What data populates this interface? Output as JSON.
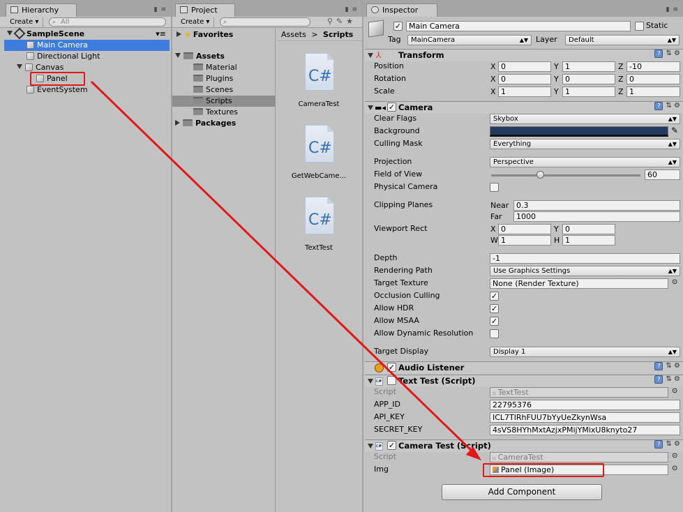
{
  "hierarchy": {
    "tab": "Hierarchy",
    "create": "Create",
    "search_placeholder": "All",
    "scene": "SampleScene",
    "items": [
      "Main Camera",
      "Directional Light",
      "Canvas",
      "Panel",
      "EventSystem"
    ]
  },
  "project": {
    "tab": "Project",
    "create": "Create",
    "favorites": "Favorites",
    "assets": "Assets",
    "folders": [
      "Material",
      "Plugins",
      "Scenes",
      "Scripts",
      "Textures"
    ],
    "packages": "Packages",
    "breadcrumb": [
      "Assets",
      "Scripts"
    ],
    "files": [
      {
        "icon": "C#",
        "name": "CameraTest"
      },
      {
        "icon": "C#",
        "name": "GetWebCame..."
      },
      {
        "icon": "C#",
        "name": "TextTest"
      }
    ]
  },
  "inspector": {
    "tab": "Inspector",
    "object_name": "Main Camera",
    "static_label": "Static",
    "tag_label": "Tag",
    "tag_value": "MainCamera",
    "layer_label": "Layer",
    "layer_value": "Default",
    "transform": {
      "title": "Transform",
      "position_label": "Position",
      "rotation_label": "Rotation",
      "scale_label": "Scale",
      "x": "X",
      "y": "Y",
      "z": "Z",
      "position": [
        "0",
        "1",
        "-10"
      ],
      "rotation": [
        "0",
        "0",
        "0"
      ],
      "scale": [
        "1",
        "1",
        "1"
      ]
    },
    "camera": {
      "title": "Camera",
      "clear_flags_label": "Clear Flags",
      "clear_flags": "Skybox",
      "background_label": "Background",
      "background_color": "#223a5e",
      "culling_mask_label": "Culling Mask",
      "culling_mask": "Everything",
      "projection_label": "Projection",
      "projection": "Perspective",
      "fov_label": "Field of View",
      "fov": "60",
      "fov_fraction": 0.33,
      "physical_label": "Physical Camera",
      "clipping_label": "Clipping Planes",
      "near_label": "Near",
      "near": "0.3",
      "far_label": "Far",
      "far": "1000",
      "viewport_label": "Viewport Rect",
      "x_label": "X",
      "x": "0",
      "y_label": "Y",
      "y": "0",
      "w_label": "W",
      "w": "1",
      "h_label": "H",
      "h": "1",
      "depth_label": "Depth",
      "depth": "-1",
      "rendering_path_label": "Rendering Path",
      "rendering_path": "Use Graphics Settings",
      "target_texture_label": "Target Texture",
      "target_texture": "None (Render Texture)",
      "occlusion_label": "Occlusion Culling",
      "hdr_label": "Allow HDR",
      "msaa_label": "Allow MSAA",
      "dynres_label": "Allow Dynamic Resolution",
      "target_display_label": "Target Display",
      "target_display": "Display 1"
    },
    "audio": {
      "title": "Audio Listener"
    },
    "text_test": {
      "title": "Text Test (Script)",
      "script_label": "Script",
      "script": "TextTest",
      "app_id_label": "APP_ID",
      "app_id": "22795376",
      "api_key_label": "API_KEY",
      "api_key": "ICL7TlRhFUU7bYyUeZkynWsa",
      "secret_key_label": "SECRET_KEY",
      "secret_key": "4sVS8HYhMxtAzjxPMijYMixU8knyto27"
    },
    "camera_test": {
      "title": "Camera Test (Script)",
      "script_label": "Script",
      "script": "CameraTest",
      "img_label": "Img",
      "img": "Panel (Image)"
    },
    "add_component": "Add Component"
  },
  "icons": {
    "check": "✓",
    "gear": "⚙",
    "lock": "🔒",
    "csharp": "C#"
  },
  "colors": {
    "selection": "#3e7de0",
    "annotation_red": "#e01818"
  }
}
